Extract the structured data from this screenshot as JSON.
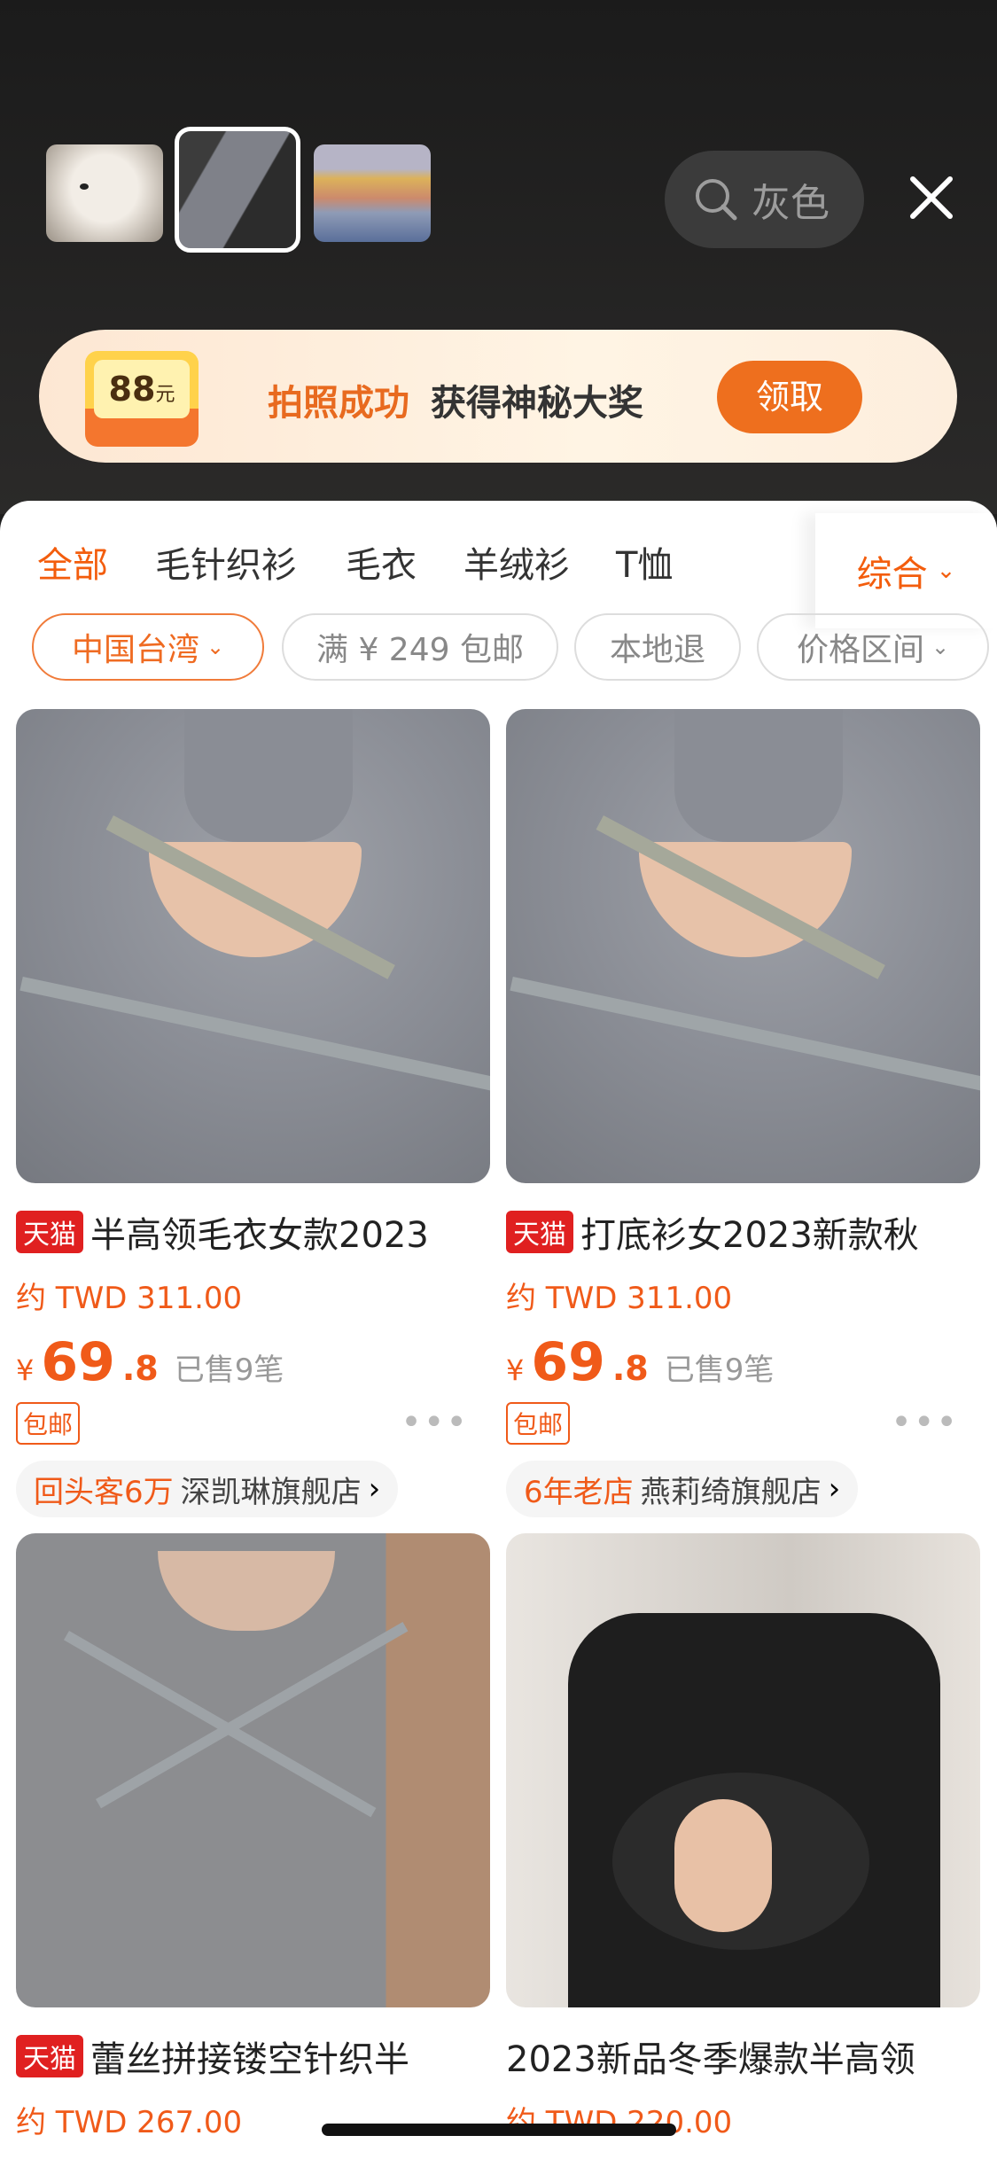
{
  "search": {
    "query": "灰色"
  },
  "promo": {
    "badge": "88",
    "badge_unit": "元",
    "text_highlight": "拍照成功",
    "text_rest": "获得神秘大奖",
    "button": "领取"
  },
  "categories": [
    "全部",
    "毛针织衫",
    "毛衣",
    "羊绒衫",
    "T恤"
  ],
  "sort_label": "综合",
  "filters": [
    "中国台湾",
    "满 ¥ 249 包邮",
    "本地退",
    "价格区间"
  ],
  "products": [
    {
      "tag": "天猫",
      "title": "半高领毛衣女款2023",
      "twd": "约 TWD 311.00",
      "yen": "¥",
      "price_int": "69",
      "price_dec": ".8",
      "sold": "已售9笔",
      "ship": "包邮",
      "store_hi": "回头客6万",
      "store": "深凯琳旗舰店",
      "arrow": "›"
    },
    {
      "tag": "天猫",
      "title": "打底衫女2023新款秋",
      "twd": "约 TWD 311.00",
      "yen": "¥",
      "price_int": "69",
      "price_dec": ".8",
      "sold": "已售9笔",
      "ship": "包邮",
      "store_hi": "6年老店",
      "store": "燕莉绮旗舰店",
      "arrow": "›"
    },
    {
      "tag": "天猫",
      "title": "蕾丝拼接镂空针织半",
      "twd": "约 TWD 267.00"
    },
    {
      "tag": "",
      "title": "2023新品冬季爆款半高领",
      "twd": "约 TWD 220.00"
    }
  ],
  "icons": {
    "search": "search-icon",
    "close": "close-icon",
    "chevron": "chevron-down-icon",
    "more": "more-icon"
  },
  "colors": {
    "accent": "#f05a19",
    "tmall": "#e02020"
  }
}
